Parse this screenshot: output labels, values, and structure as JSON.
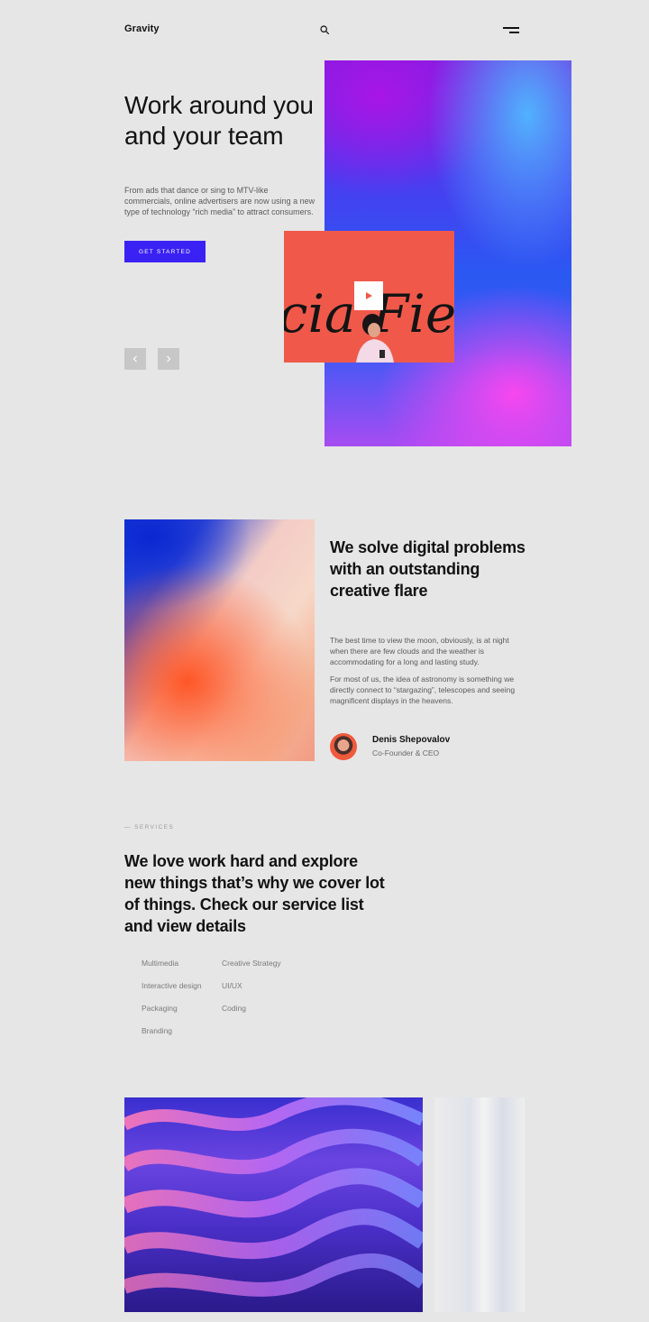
{
  "header": {
    "logo": "Gravity",
    "icons": {
      "search": "search-icon",
      "menu": "menu-icon"
    }
  },
  "hero": {
    "title": "Work around you and your team",
    "description": "From ads that dance or sing to MTV-like commercials, online advertisers are now using a new type of technology “rich media” to attract consumers.",
    "cta_label": "GET STARTED",
    "video_text": "cia Fie",
    "icons": {
      "prev": "chevron-left-icon",
      "next": "chevron-right-icon",
      "play": "play-icon"
    }
  },
  "about": {
    "title": "We solve digital problems with an outstanding creative flare",
    "paragraphs": [
      "The best time to view the moon, obviously, is at night when there are few clouds and the weather is accommodating for a long and lasting study.",
      "For most of us, the idea of astronomy is something we directly connect to “stargazing”, telescopes and seeing magnificent displays in the heavens."
    ],
    "author": {
      "name": "Denis Shepovalov",
      "role": "Co-Founder & CEO"
    }
  },
  "services": {
    "label": "— SERVICES",
    "title": "We love work hard and explore new things that’s why we cover lot of things. Check our service list and view details",
    "column_1": [
      "Multimedia",
      "Interactive design",
      "Packaging",
      "Branding"
    ],
    "column_2": [
      "Creative Strategy",
      "UI/UX",
      "Coding"
    ]
  },
  "colors": {
    "background": "#e6e6e6",
    "accent": "#3a22f4",
    "text": "#121212",
    "muted": "#5a5a5a",
    "video_card": "#f0594a"
  }
}
